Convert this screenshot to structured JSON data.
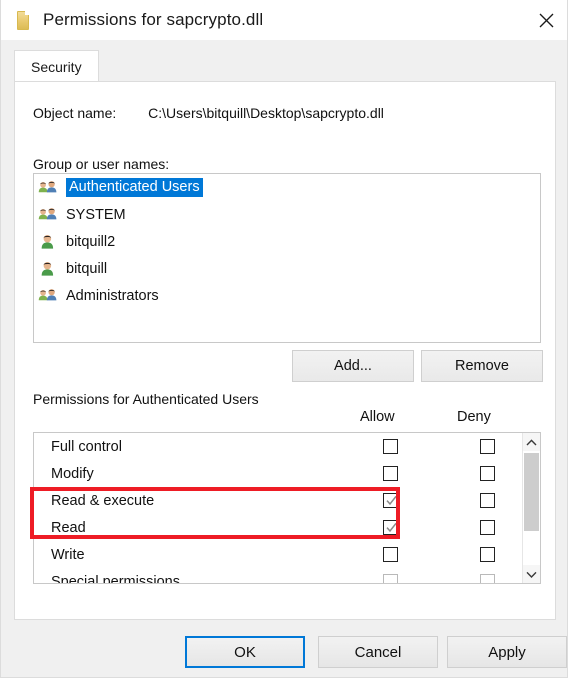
{
  "window": {
    "title": "Permissions for sapcrypto.dll",
    "icon": "document-icon",
    "close_icon": "close-icon"
  },
  "tabs": [
    {
      "label": "Security",
      "selected": true
    }
  ],
  "object": {
    "label": "Object name:",
    "value": "C:\\Users\\bitquill\\Desktop\\sapcrypto.dll"
  },
  "group_section": {
    "label": "Group or user names:",
    "items": [
      {
        "name": "Authenticated Users",
        "icon": "group-icon",
        "selected": true
      },
      {
        "name": "SYSTEM",
        "icon": "group-icon",
        "selected": false
      },
      {
        "name": "bitquill2",
        "icon": "user-icon",
        "selected": false
      },
      {
        "name": "bitquill",
        "icon": "user-icon",
        "selected": false
      },
      {
        "name": "Administrators",
        "icon": "group-icon",
        "selected": false
      }
    ],
    "buttons": {
      "add": "Add...",
      "remove": "Remove"
    }
  },
  "permissions_section": {
    "title": "Permissions for Authenticated Users",
    "columns": [
      "Allow",
      "Deny"
    ],
    "rows": [
      {
        "name": "Full control",
        "allow": false,
        "deny": false,
        "dim": false
      },
      {
        "name": "Modify",
        "allow": false,
        "deny": false,
        "dim": false
      },
      {
        "name": "Read & execute",
        "allow": true,
        "deny": false,
        "dim": false
      },
      {
        "name": "Read",
        "allow": true,
        "deny": false,
        "dim": false
      },
      {
        "name": "Write",
        "allow": false,
        "deny": false,
        "dim": false
      },
      {
        "name": "Special permissions",
        "allow": false,
        "deny": false,
        "dim": true
      }
    ],
    "scrollbar": {
      "up_icon": "chevron-up-icon",
      "down_icon": "chevron-down-icon"
    }
  },
  "annotation": {
    "color": "#ee1c25",
    "highlights": [
      "Read & execute",
      "Read"
    ]
  },
  "footer": {
    "ok": "OK",
    "cancel": "Cancel",
    "apply": "Apply"
  },
  "colors": {
    "selection": "#0078d7",
    "focus": "#0078d7",
    "dialog_bg": "#f0f0f0",
    "panel_bg": "#ffffff"
  }
}
